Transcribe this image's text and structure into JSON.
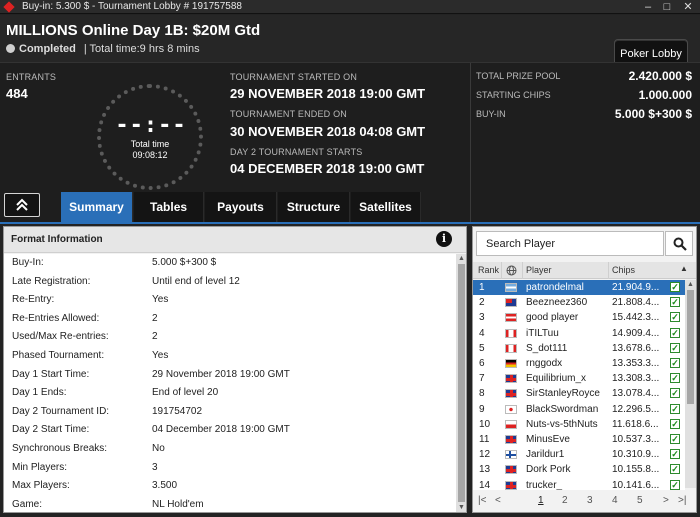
{
  "window": {
    "title": "Buy-in: 5.300 $ - Tournament Lobby # 191757588"
  },
  "header": {
    "tournament_name": "MILLIONS Online Day 1B: $20M Gtd",
    "status": "Completed",
    "total_time": "| Total time:9 hrs  8 mins",
    "poker_lobby_button": "Poker Lobby"
  },
  "info": {
    "entrants_label": "ENTRANTS",
    "entrants_value": "484",
    "clock_digits": "--:--",
    "clock_label": "Total time",
    "clock_value": "09:08:12",
    "started_label": "TOURNAMENT STARTED ON",
    "started_value": "29 NOVEMBER 2018   19:00 GMT",
    "ended_label": "TOURNAMENT ENDED ON",
    "ended_value": "30 NOVEMBER 2018   04:08 GMT",
    "day2_label": "DAY 2 TOURNAMENT STARTS",
    "day2_value": "04 DECEMBER 2018   19:00 GMT",
    "prize_pool_label": "TOTAL PRIZE POOL",
    "prize_pool_value": "2.420.000 $",
    "starting_chips_label": "STARTING CHIPS",
    "starting_chips_value": "1.000.000",
    "buyin_label": "BUY-IN",
    "buyin_value": "5.000 $+300 $"
  },
  "tabs": [
    "Summary",
    "Tables",
    "Payouts",
    "Structure",
    "Satellites"
  ],
  "format": {
    "title": "Format Information",
    "rows": [
      {
        "k": "Buy-In:",
        "v": "5.000 $+300 $"
      },
      {
        "k": "Late Registration:",
        "v": "Until end of level 12"
      },
      {
        "k": "Re-Entry:",
        "v": "Yes"
      },
      {
        "k": "Re-Entries Allowed:",
        "v": "2"
      },
      {
        "k": "Used/Max Re-entries:",
        "v": "2"
      },
      {
        "k": "Phased Tournament:",
        "v": "Yes"
      },
      {
        "k": "Day 1 Start Time:",
        "v": "29 November 2018  19:00 GMT"
      },
      {
        "k": "Day 1 Ends:",
        "v": "End of level 20"
      },
      {
        "k": "Day 2 Tournament ID:",
        "v": "191754702"
      },
      {
        "k": "Day 2 Start Time:",
        "v": "04 December 2018  19:00 GMT"
      },
      {
        "k": "Synchronous Breaks:",
        "v": "No"
      },
      {
        "k": "Min Players:",
        "v": "3"
      },
      {
        "k": "Max Players:",
        "v": "3.500"
      },
      {
        "k": "Game:",
        "v": "NL Hold'em"
      }
    ]
  },
  "players": {
    "search_placeholder": "Search Player",
    "columns": {
      "rank": "Rank",
      "player": "Player",
      "chips": "Chips"
    },
    "rows": [
      {
        "rank": "1",
        "flag": "ar",
        "name": "patrondelmal",
        "chips": "21.904.9..."
      },
      {
        "rank": "2",
        "flag": "au",
        "name": "Beezneez360",
        "chips": "21.808.4..."
      },
      {
        "rank": "3",
        "flag": "at",
        "name": "good player",
        "chips": "15.442.3..."
      },
      {
        "rank": "4",
        "flag": "ca",
        "name": "iTILTuu",
        "chips": "14.909.4..."
      },
      {
        "rank": "5",
        "flag": "ca",
        "name": "S_dot111",
        "chips": "13.678.6..."
      },
      {
        "rank": "6",
        "flag": "de",
        "name": "rnggodx",
        "chips": "13.353.3..."
      },
      {
        "rank": "7",
        "flag": "gb",
        "name": "Equilibrium_x",
        "chips": "13.308.3..."
      },
      {
        "rank": "8",
        "flag": "gb",
        "name": "SirStanleyRoyce",
        "chips": "13.078.4..."
      },
      {
        "rank": "9",
        "flag": "jp",
        "name": "BlackSwordman",
        "chips": "12.296.5..."
      },
      {
        "rank": "10",
        "flag": "pl",
        "name": "Nuts-vs-5thNuts",
        "chips": "11.618.6..."
      },
      {
        "rank": "11",
        "flag": "gb",
        "name": "MinusEve",
        "chips": "10.537.3..."
      },
      {
        "rank": "12",
        "flag": "fi",
        "name": "Jarildur1",
        "chips": "10.310.9..."
      },
      {
        "rank": "13",
        "flag": "gb",
        "name": "Dork Pork",
        "chips": "10.155.8..."
      },
      {
        "rank": "14",
        "flag": "gb",
        "name": "trucker_",
        "chips": "10.141.6..."
      }
    ],
    "pager": {
      "first": "|<",
      "prev": "<",
      "pages": [
        "1",
        "2",
        "3",
        "4",
        "5"
      ],
      "next": ">",
      "last": ">|"
    }
  }
}
